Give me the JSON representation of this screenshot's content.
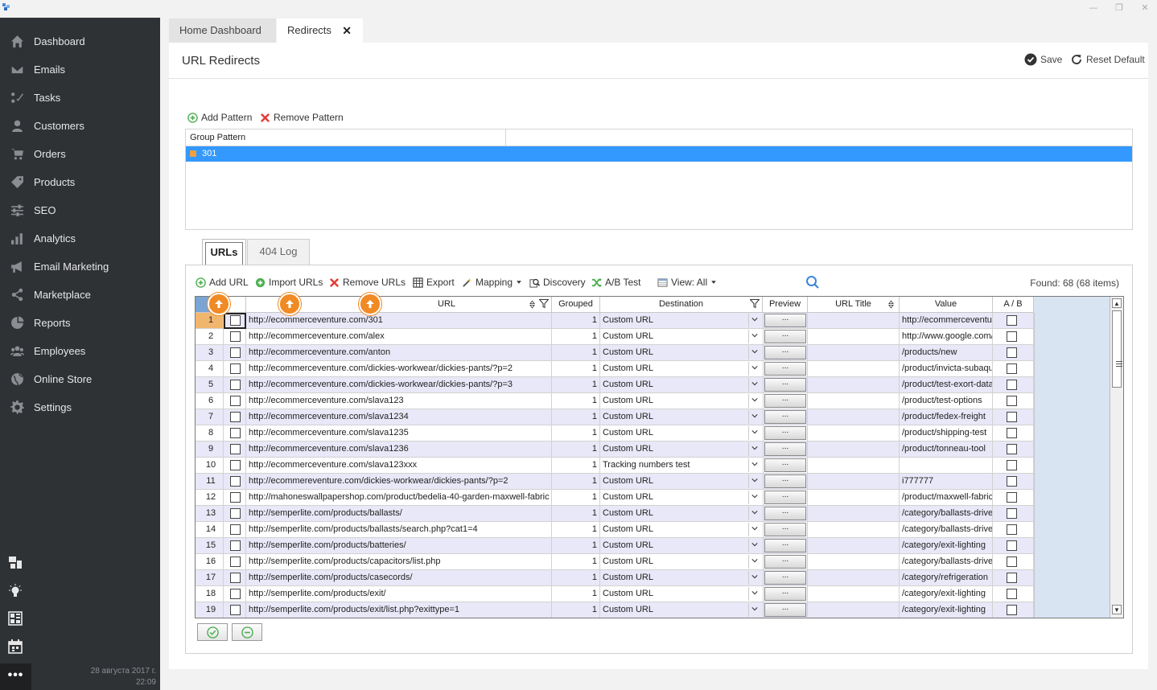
{
  "window": {
    "minimize_glyph": "—",
    "restore_glyph": "❐",
    "close_glyph": "✕"
  },
  "sidebar": {
    "items": [
      {
        "label": "Dashboard",
        "icon": "home-icon"
      },
      {
        "label": "Emails",
        "icon": "envelope-icon"
      },
      {
        "label": "Tasks",
        "icon": "tasks-icon"
      },
      {
        "label": "Customers",
        "icon": "user-icon"
      },
      {
        "label": "Orders",
        "icon": "cart-icon"
      },
      {
        "label": "Products",
        "icon": "tag-icon"
      },
      {
        "label": "SEO",
        "icon": "sliders-icon"
      },
      {
        "label": "Analytics",
        "icon": "bar-chart-icon"
      },
      {
        "label": "Email Marketing",
        "icon": "megaphone-icon"
      },
      {
        "label": "Marketplace",
        "icon": "share-icon"
      },
      {
        "label": "Reports",
        "icon": "pie-chart-icon"
      },
      {
        "label": "Employees",
        "icon": "users-icon"
      },
      {
        "label": "Online Store",
        "icon": "globe-icon"
      },
      {
        "label": "Settings",
        "icon": "gear-icon"
      }
    ],
    "more_label": "•••",
    "date": "28 августа 2017 г.",
    "time": "22:09"
  },
  "tabs": {
    "home": "Home Dashboard",
    "redirects": "Redirects",
    "close_glyph": "✕"
  },
  "page": {
    "title": "URL Redirects",
    "save": "Save",
    "reset": "Reset Default"
  },
  "patterns": {
    "add": "Add Pattern",
    "remove": "Remove Pattern",
    "column": "Group Pattern",
    "rows": [
      "301"
    ]
  },
  "subtabs": {
    "urls": "URLs",
    "log": "404 Log"
  },
  "toolbar": {
    "add_url": "Add URL",
    "import_urls": "Import URLs",
    "remove_urls": "Remove URLs",
    "export": "Export",
    "mapping": "Mapping",
    "discovery": "Discovery",
    "ab_test": "A/B Test",
    "view": "View: All",
    "found": "Found: 68 (68 items)"
  },
  "grid": {
    "columns": {
      "url": "URL",
      "grouped": "Grouped",
      "destination": "Destination",
      "preview": "Preview",
      "url_title": "URL Title",
      "value": "Value",
      "ab": "A / B"
    },
    "preview_btn": "...",
    "rows": [
      {
        "n": "1",
        "url": "http://ecommerceventure.com/301",
        "grouped": "1",
        "dest": "Custom URL",
        "value": "http://ecommerceventure.com/"
      },
      {
        "n": "2",
        "url": "http://ecommerceventure.com/alex",
        "grouped": "1",
        "dest": "Custom URL",
        "value": "http://www.google.com/"
      },
      {
        "n": "3",
        "url": "http://ecommerceventure.com/anton",
        "grouped": "1",
        "dest": "Custom URL",
        "value": "/products/new"
      },
      {
        "n": "4",
        "url": "http://ecommerceventure.com/dickies-workwear/dickies-pants/?p=2",
        "grouped": "1",
        "dest": "Custom URL",
        "value": "/product/invicta-subaqua"
      },
      {
        "n": "5",
        "url": "http://ecommerceventure.com/dickies-workwear/dickies-pants/?p=3",
        "grouped": "1",
        "dest": "Custom URL",
        "value": "/product/test-exort-data"
      },
      {
        "n": "6",
        "url": "http://ecommerceventure.com/slava123",
        "grouped": "1",
        "dest": "Custom URL",
        "value": "/product/test-options"
      },
      {
        "n": "7",
        "url": "http://ecommerceventure.com/slava1234",
        "grouped": "1",
        "dest": "Custom URL",
        "value": "/product/fedex-freight"
      },
      {
        "n": "8",
        "url": "http://ecommerceventure.com/slava1235",
        "grouped": "1",
        "dest": "Custom URL",
        "value": "/product/shipping-test"
      },
      {
        "n": "9",
        "url": "http://ecommerceventure.com/slava1236",
        "grouped": "1",
        "dest": "Custom URL",
        "value": "/product/tonneau-tool"
      },
      {
        "n": "10",
        "url": "http://ecommerceventure.com/slava123xxx",
        "grouped": "1",
        "dest": "Tracking numbers test",
        "value": ""
      },
      {
        "n": "11",
        "url": "http://ecommereventure.com/dickies-workwear/dickies-pants/?p=2",
        "grouped": "1",
        "dest": "Custom URL",
        "value": "i777777"
      },
      {
        "n": "12",
        "url": "http://mahoneswallpapershop.com/product/bedelia-40-garden-maxwell-fabric",
        "grouped": "1",
        "dest": "Custom URL",
        "value": "/product/maxwell-fabric"
      },
      {
        "n": "13",
        "url": "http://semperlite.com/products/ballasts/",
        "grouped": "1",
        "dest": "Custom URL",
        "value": "/category/ballasts-drivers"
      },
      {
        "n": "14",
        "url": "http://semperlite.com/products/ballasts/search.php?cat1=4",
        "grouped": "1",
        "dest": "Custom URL",
        "value": "/category/ballasts-drivers"
      },
      {
        "n": "15",
        "url": "http://semperlite.com/products/batteries/",
        "grouped": "1",
        "dest": "Custom URL",
        "value": "/category/exit-lighting"
      },
      {
        "n": "16",
        "url": "http://semperlite.com/products/capacitors/list.php",
        "grouped": "1",
        "dest": "Custom URL",
        "value": "/category/ballasts-drivers"
      },
      {
        "n": "17",
        "url": "http://semperlite.com/products/casecords/",
        "grouped": "1",
        "dest": "Custom URL",
        "value": "/category/refrigeration"
      },
      {
        "n": "18",
        "url": "http://semperlite.com/products/exit/",
        "grouped": "1",
        "dest": "Custom URL",
        "value": "/category/exit-lighting"
      },
      {
        "n": "19",
        "url": "http://semperlite.com/products/exit/list.php?exittype=1",
        "grouped": "1",
        "dest": "Custom URL",
        "value": "/category/exit-lighting"
      }
    ]
  },
  "colors": {
    "sidebar_bg": "#2f3235",
    "selection": "#3399ff",
    "accent_orange": "#f08a24",
    "alt_row": "#e8e8f8"
  }
}
